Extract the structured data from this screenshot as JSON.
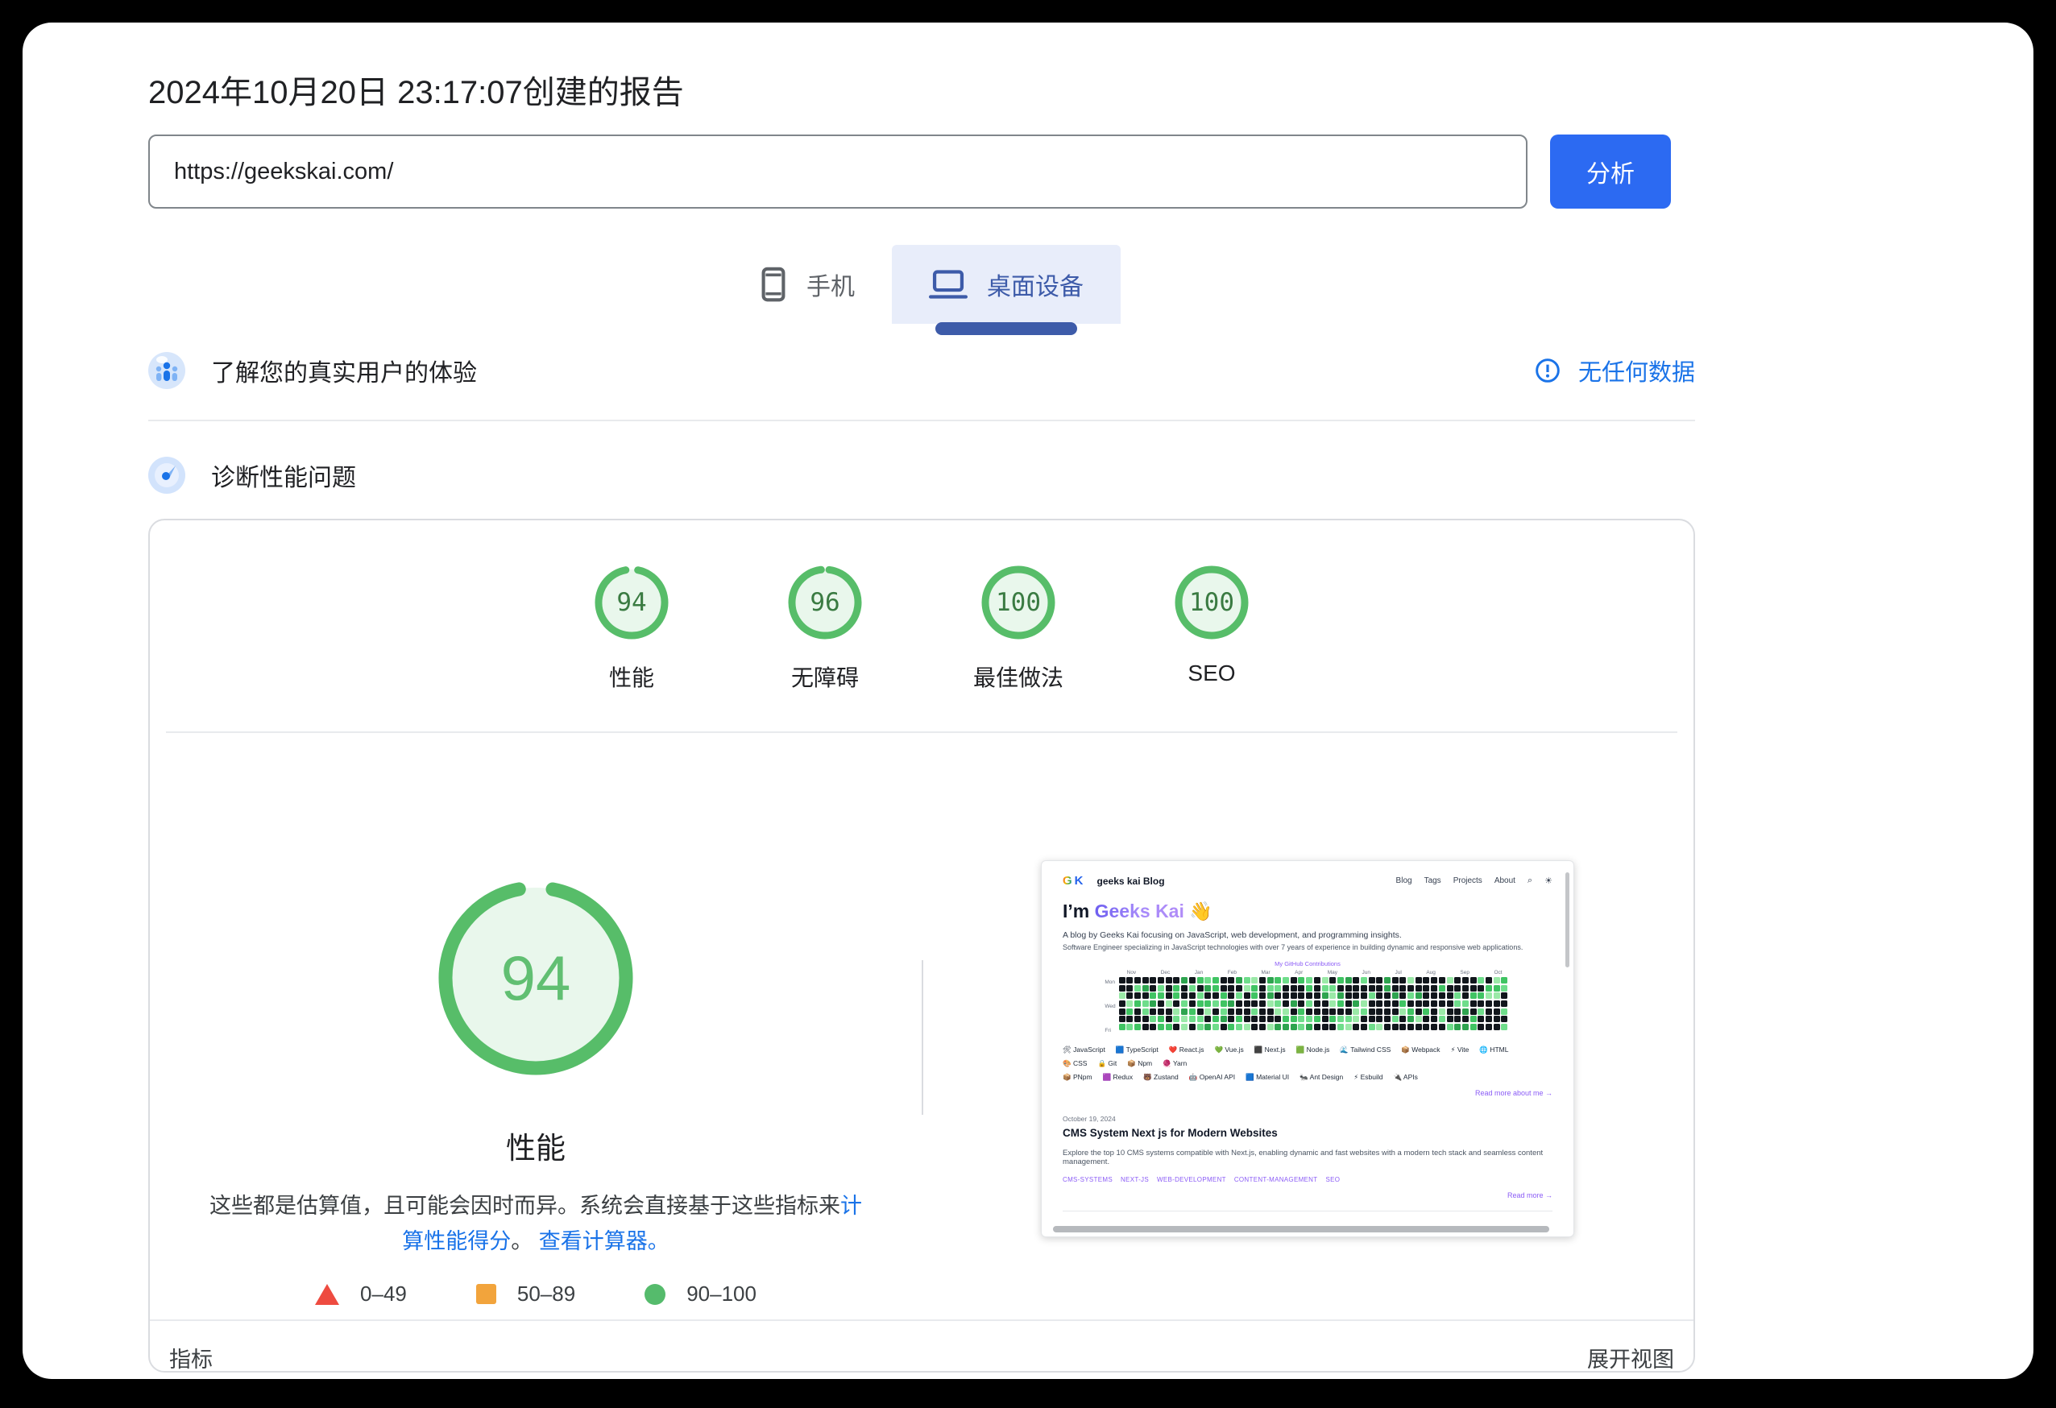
{
  "page": {
    "title": "2024年10月20日 23:17:07创建的报告"
  },
  "analyze": {
    "url_value": "https://geekskai.com/",
    "button_label": "分析"
  },
  "tabs": [
    {
      "label": "手机",
      "active": false,
      "icon": "mobile-phone-icon"
    },
    {
      "label": "桌面设备",
      "active": true,
      "icon": "laptop-icon"
    }
  ],
  "sections": {
    "field": {
      "title": "了解您的真实用户的体验",
      "status_link": "无任何数据",
      "icon": "users-icon",
      "status_icon": "info-icon"
    },
    "diagnose": {
      "title": "诊断性能问题",
      "icon": "speedometer-icon"
    }
  },
  "scores": {
    "items": [
      {
        "value": 94,
        "label": "性能"
      },
      {
        "value": 96,
        "label": "无障碍"
      },
      {
        "value": 100,
        "label": "最佳做法"
      },
      {
        "value": 100,
        "label": "SEO"
      }
    ],
    "ring_color": "#57bd69",
    "fill_color": "#e9f7ec",
    "number_color": "#3a7b42"
  },
  "gauge": {
    "value": 94,
    "label": "性能",
    "desc_plain": "这些都是估算值，且可能会因时而异。系统会直接基于这些指标来",
    "desc_link1": "计算性能得分",
    "desc_sep": "。 ",
    "desc_link2": "查看计算器。",
    "number_color": "#61bf72"
  },
  "legend": [
    {
      "range": "0–49",
      "shape": "triangle",
      "color": "#ee4b40"
    },
    {
      "range": "50–89",
      "shape": "square",
      "color": "#f2a43c"
    },
    {
      "range": "90–100",
      "shape": "circle",
      "color": "#55bb6c"
    }
  ],
  "footer": {
    "left": "指标",
    "right": "展开视图"
  },
  "thumbnail": {
    "logo_g": "G",
    "logo_k": "K",
    "site_name": "geeks kai Blog",
    "nav": [
      "Blog",
      "Tags",
      "Projects",
      "About"
    ],
    "nav_icons": [
      "search-icon",
      "theme-sun-icon"
    ],
    "hero_prefix": "I’m ",
    "hero_name": "Geeks Kai",
    "hero_emoji": "👋",
    "intro1": "A blog by Geeks Kai focusing on JavaScript, web development, and programming insights.",
    "intro2": "Software Engineer specializing in JavaScript technologies with over 7 years of experience in building dynamic and responsive web applications.",
    "contrib_title": "My GitHub Contributions",
    "heatmap": {
      "months": [
        "Nov",
        "Dec",
        "Jan",
        "Feb",
        "Mar",
        "Apr",
        "May",
        "Jun",
        "Jul",
        "Aug",
        "Sep",
        "Oct"
      ],
      "day_labels": [
        "Mon",
        "Wed",
        "Fri"
      ],
      "cols": 50,
      "rows": 7,
      "seed": 20241020,
      "palette_dark": "#11161c",
      "palette_greens": [
        "#9be9a8",
        "#40c463",
        "#2ea44f",
        "#6fdd8b"
      ]
    },
    "badge_rows": [
      [
        {
          "icon": "🛠",
          "label": "JavaScript"
        },
        {
          "icon": "🟦",
          "label": "TypeScript"
        },
        {
          "icon": "❤️",
          "label": "React.js"
        },
        {
          "icon": "💚",
          "label": "Vue.js"
        },
        {
          "icon": "⬛",
          "label": "Next.js"
        },
        {
          "icon": "🟩",
          "label": "Node.js"
        },
        {
          "icon": "🌊",
          "label": "Tailwind CSS"
        },
        {
          "icon": "📦",
          "label": "Webpack"
        },
        {
          "icon": "⚡",
          "label": "Vite"
        },
        {
          "icon": "🌐",
          "label": "HTML"
        },
        {
          "icon": "🎨",
          "label": "CSS"
        },
        {
          "icon": "🔒",
          "label": "Git"
        },
        {
          "icon": "📦",
          "label": "Npm"
        },
        {
          "icon": "🧶",
          "label": "Yarn"
        }
      ],
      [
        {
          "icon": "📦",
          "label": "PNpm"
        },
        {
          "icon": "🟪",
          "label": "Redux"
        },
        {
          "icon": "🐻",
          "label": "Zustand"
        },
        {
          "icon": "🤖",
          "label": "OpenAI API"
        },
        {
          "icon": "🟦",
          "label": "Material UI"
        },
        {
          "icon": "🐜",
          "label": "Ant Design"
        },
        {
          "icon": "⚡",
          "label": "Esbuild"
        },
        {
          "icon": "🔌",
          "label": "APIs"
        }
      ]
    ],
    "read_more_about": "Read more about me →",
    "post": {
      "date": "October 19, 2024",
      "title": "CMS System Next js for Modern Websites",
      "excerpt": "Explore the top 10 CMS systems compatible with Next.js, enabling dynamic and fast websites with a modern tech stack and seamless content management.",
      "tags": [
        "CMS-SYSTEMS",
        "NEXT-JS",
        "WEB-DEVELOPMENT",
        "CONTENT-MANAGEMENT",
        "SEO"
      ],
      "read_more": "Read more →"
    }
  }
}
